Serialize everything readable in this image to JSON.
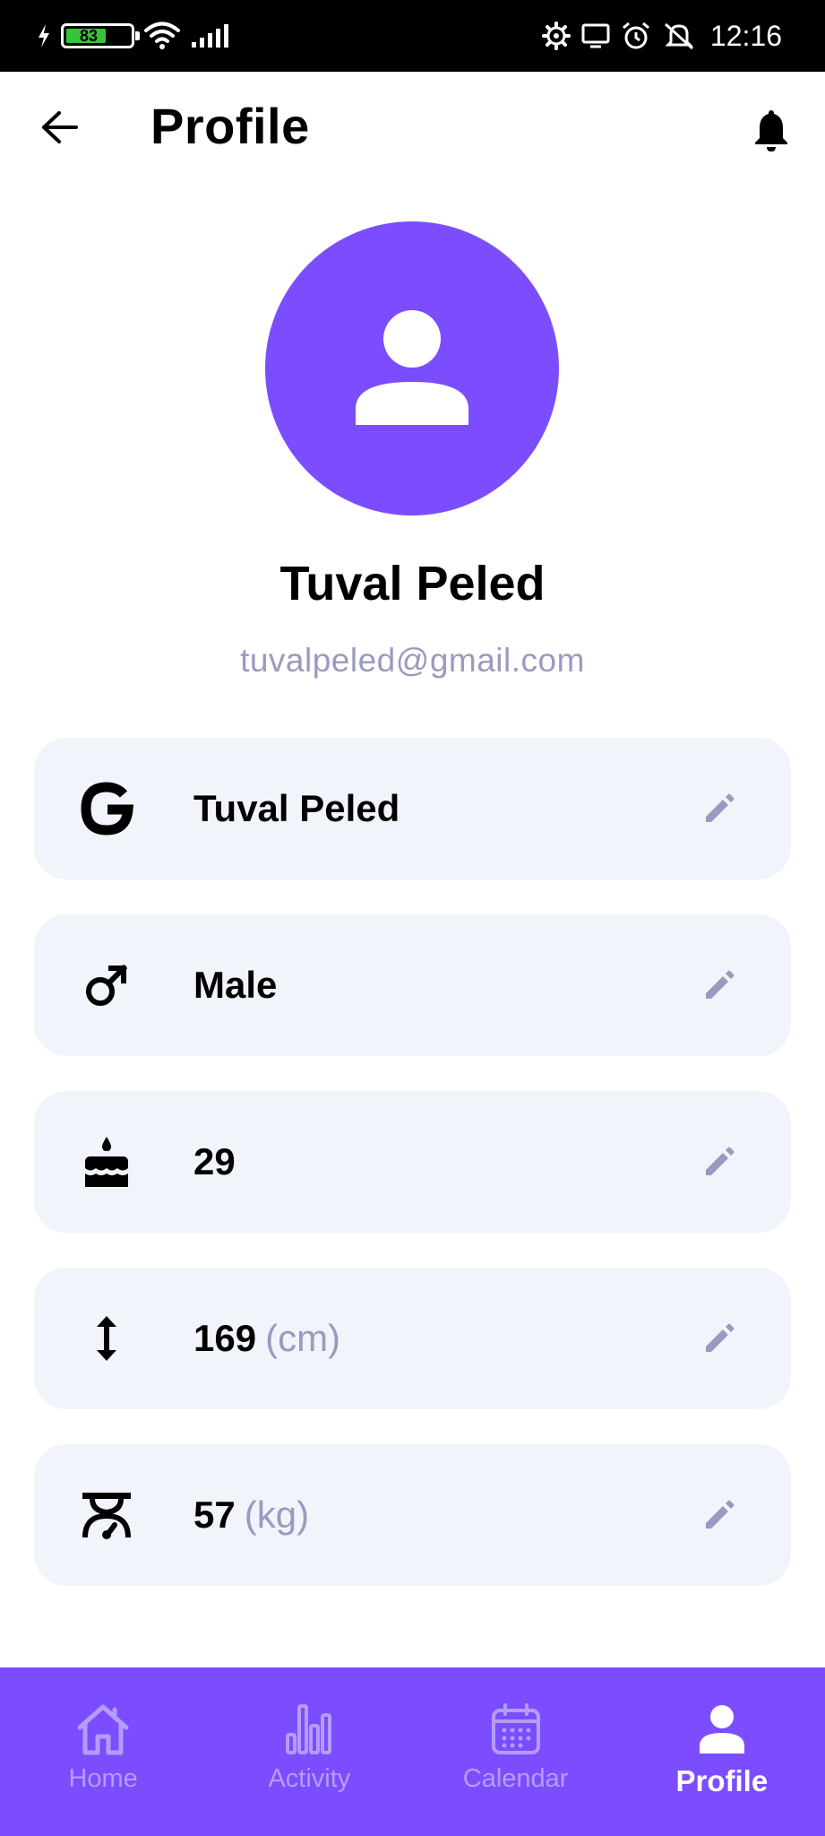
{
  "status_bar": {
    "battery_level": "83",
    "time": "12:16"
  },
  "header": {
    "title": "Profile"
  },
  "profile": {
    "name": "Tuval Peled",
    "email": "tuvalpeled@gmail.com"
  },
  "fields": [
    {
      "icon": "google-icon",
      "value": "Tuval Peled",
      "unit": ""
    },
    {
      "icon": "male-icon",
      "value": "Male",
      "unit": ""
    },
    {
      "icon": "cake-icon",
      "value": "29",
      "unit": ""
    },
    {
      "icon": "height-icon",
      "value": "169",
      "unit": "(cm)"
    },
    {
      "icon": "scale-icon",
      "value": "57",
      "unit": "(kg)"
    }
  ],
  "bottom_nav": {
    "items": [
      {
        "label": "Home",
        "icon": "home-icon",
        "active": false
      },
      {
        "label": "Activity",
        "icon": "bar-chart-icon",
        "active": false
      },
      {
        "label": "Calendar",
        "icon": "calendar-icon",
        "active": false
      },
      {
        "label": "Profile",
        "icon": "person-icon",
        "active": true
      }
    ]
  },
  "colors": {
    "accent": "#7c4dff",
    "card_background": "#f1f4fb",
    "muted_text": "#9a9ac0",
    "inactive_nav": "#b49df7"
  }
}
